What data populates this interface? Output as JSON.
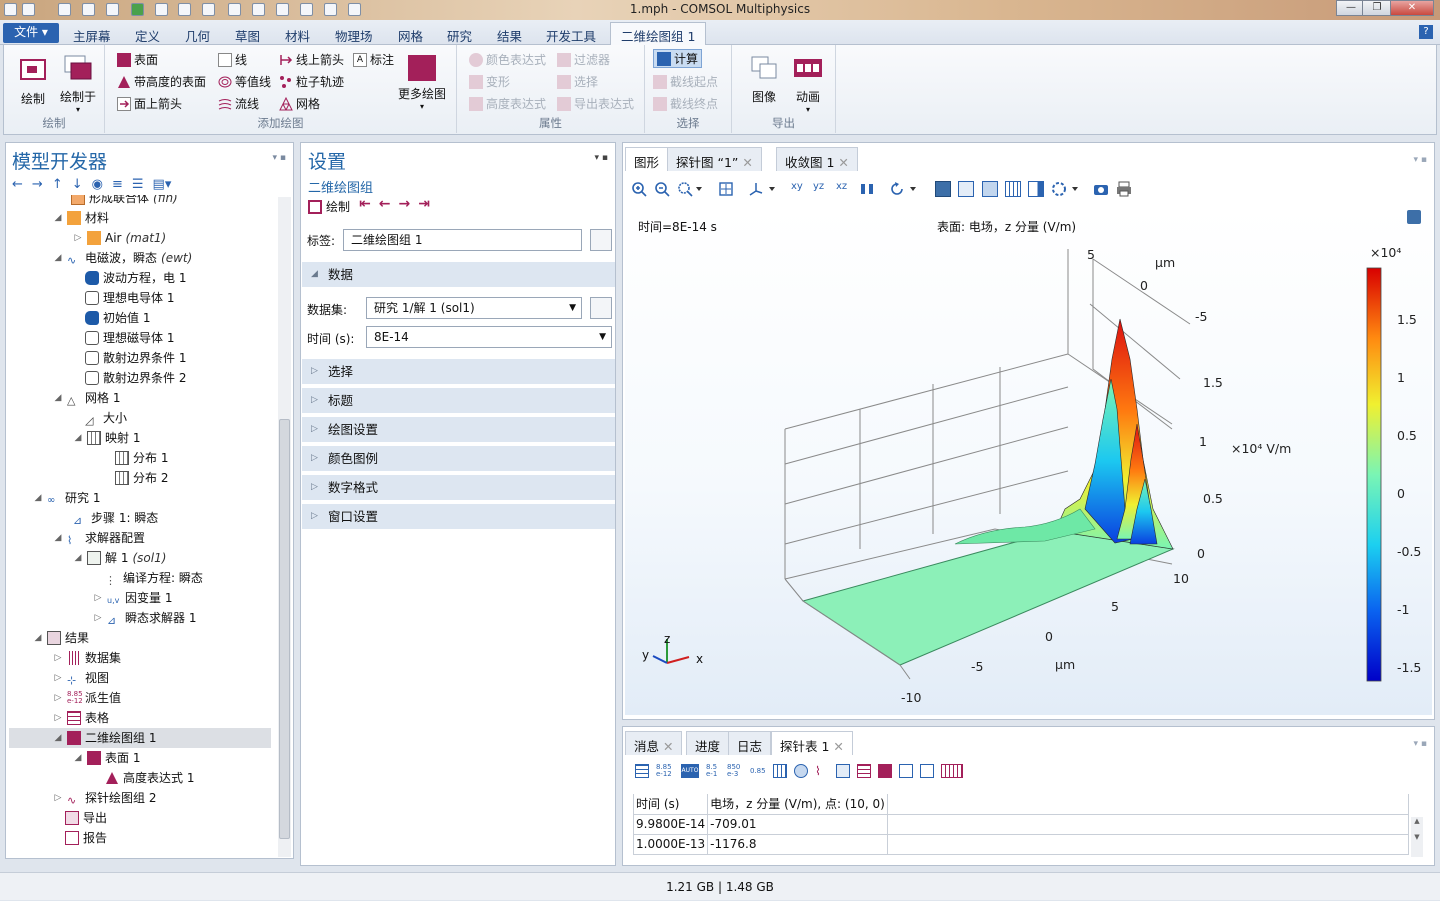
{
  "window": {
    "title": "1.mph - COMSOL Multiphysics",
    "min": "—",
    "restore": "❐",
    "close": "✕"
  },
  "ribbon_tabs": [
    "文件 ▾",
    "主屏幕",
    "定义",
    "几何",
    "草图",
    "材料",
    "物理场",
    "网格",
    "研究",
    "结果",
    "开发工具",
    "二维绘图组 1"
  ],
  "help": "?",
  "ribbon": {
    "draw_group": {
      "label": "绘制",
      "plot": "绘制",
      "plot_in": "绘制于"
    },
    "add_plot": {
      "label": "添加绘图",
      "surface": "表面",
      "height_surface": "带高度的表面",
      "arrow_surface": "面上箭头",
      "line": "线",
      "contour": "等值线",
      "streamline": "流线",
      "arrow_line": "线上箭头",
      "particle": "粒子轨迹",
      "mesh": "网格",
      "annotation": "标注",
      "more_plots": "更多绘图"
    },
    "attributes": {
      "label": "属性",
      "color_expression": "颜色表达式",
      "deformation": "变形",
      "height_expression": "高度表达式",
      "filter": "过滤器",
      "selection": "选择",
      "export_expression": "导出表达式"
    },
    "select": {
      "label": "选择",
      "compute": "计算",
      "cutline_start": "截线起点",
      "cutline_end": "截线终点"
    },
    "export": {
      "label": "导出",
      "image": "图像",
      "animation": "动画"
    }
  },
  "model_builder": {
    "title": "模型开发器",
    "tree": [
      {
        "label": "形成联合体",
        "tag": "(fin)"
      },
      {
        "label": "材料"
      },
      {
        "label": "Air",
        "tag": "(mat1)"
      },
      {
        "label": "电磁波，瞬态",
        "tag": "(ewt)"
      },
      {
        "label": "波动方程，电 1"
      },
      {
        "label": "理想电导体 1"
      },
      {
        "label": "初始值 1"
      },
      {
        "label": "理想磁导体 1"
      },
      {
        "label": "散射边界条件 1"
      },
      {
        "label": "散射边界条件 2"
      },
      {
        "label": "网格 1"
      },
      {
        "label": "大小"
      },
      {
        "label": "映射 1"
      },
      {
        "label": "分布 1"
      },
      {
        "label": "分布 2"
      },
      {
        "label": "研究 1"
      },
      {
        "label": "步骤 1: 瞬态"
      },
      {
        "label": "求解器配置"
      },
      {
        "label": "解 1",
        "tag": "(sol1)"
      },
      {
        "label": "编译方程: 瞬态"
      },
      {
        "label": "因变量 1"
      },
      {
        "label": "瞬态求解器 1"
      },
      {
        "label": "结果"
      },
      {
        "label": "数据集"
      },
      {
        "label": "视图"
      },
      {
        "label": "派生值"
      },
      {
        "label": "表格"
      },
      {
        "label": "二维绘图组 1"
      },
      {
        "label": "表面 1"
      },
      {
        "label": "高度表达式 1"
      },
      {
        "label": "探针绘图组 2"
      },
      {
        "label": "导出"
      },
      {
        "label": "报告"
      }
    ]
  },
  "settings": {
    "title": "设置",
    "subtitle": "二维绘图组",
    "plot": "绘制",
    "label_caption": "标签:",
    "label_value": "二维绘图组 1",
    "data_section": "数据",
    "dataset_caption": "数据集:",
    "dataset_value": "研究 1/解 1 (sol1)",
    "time_caption": "时间 (s):",
    "time_value": "8E-14",
    "sections": [
      "选择",
      "标题",
      "绘图设置",
      "颜色图例",
      "数字格式",
      "窗口设置"
    ]
  },
  "graphics": {
    "tabs": [
      "图形",
      "探针图 “1”",
      "收敛图 1"
    ],
    "time_text": "时间=8E-14 s",
    "surface_text": "表面: 电场，z 分量 (V/m)",
    "axis_unit": "μm",
    "z_unit": "×10⁴ V/m",
    "x_ticks": [
      "-10",
      "-5",
      "0",
      "5",
      "10"
    ],
    "y_ticks": [
      "5",
      "0",
      "-5"
    ],
    "z_ticks": [
      "0",
      "0.5",
      "1",
      "1.5"
    ],
    "colorbar": {
      "exponent": "×10⁴",
      "ticks": [
        "1.5",
        "1",
        "0.5",
        "0",
        "-0.5",
        "-1",
        "-1.5"
      ]
    },
    "triad": {
      "x": "x",
      "y": "y",
      "z": "z"
    }
  },
  "messages": {
    "tabs": [
      "消息",
      "进度",
      "日志",
      "探针表 1"
    ],
    "columns": [
      "时间 (s)",
      "电场，z 分量 (V/m), 点: (10, 0)"
    ],
    "rows": [
      [
        "9.9800E-14",
        "-709.01"
      ],
      [
        "1.0000E-13",
        "-1176.8"
      ]
    ]
  },
  "status": {
    "memory": "1.21 GB | 1.48 GB"
  },
  "colors": {
    "accent": "#2467a8",
    "plot_purple": "#a3205a"
  }
}
